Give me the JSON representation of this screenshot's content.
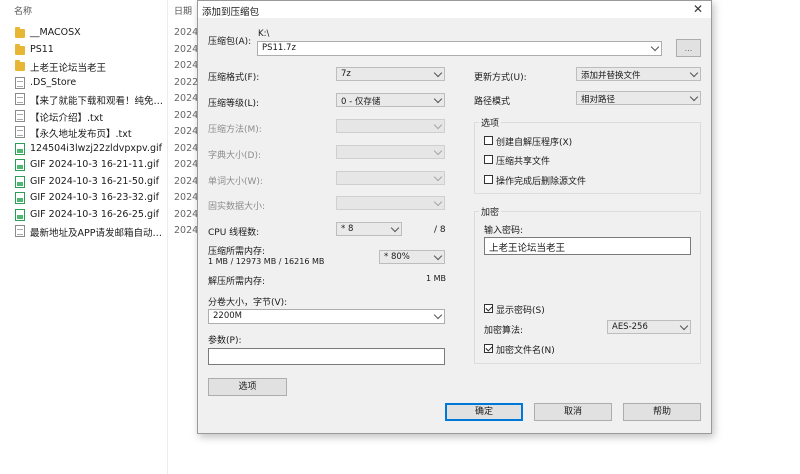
{
  "explorer": {
    "col_name": "名称",
    "col_date": "日期",
    "up_icon": "chevron-up-icon",
    "files": [
      {
        "name": "__MACOSX",
        "date": "2024/",
        "icon": "folder"
      },
      {
        "name": "PS11",
        "date": "2024/",
        "icon": "folder"
      },
      {
        "name": "上老王论坛当老王",
        "date": "2024/",
        "icon": "folder"
      },
      {
        "name": ".DS_Store",
        "date": "2022/",
        "icon": "doc"
      },
      {
        "name": "【来了就能下载和观看！纯免…",
        "date": "2024/",
        "icon": "doc"
      },
      {
        "name": "【论坛介绍】.txt",
        "date": "2024/",
        "icon": "doc"
      },
      {
        "name": "【永久地址发布页】.txt",
        "date": "2024/",
        "icon": "doc"
      },
      {
        "name": "124504i3lwzj22zldvpxpv.gif",
        "date": "2024/",
        "icon": "gif"
      },
      {
        "name": "GIF 2024-10-3 16-21-11.gif",
        "date": "2024/",
        "icon": "gif"
      },
      {
        "name": "GIF 2024-10-3 16-21-50.gif",
        "date": "2024/",
        "icon": "gif"
      },
      {
        "name": "GIF 2024-10-3 16-23-32.gif",
        "date": "2024/",
        "icon": "gif"
      },
      {
        "name": "GIF 2024-10-3 16-26-25.gif",
        "date": "2024/",
        "icon": "gif"
      },
      {
        "name": "最新地址及APP请发邮箱自动…",
        "date": "2024/",
        "icon": "doc"
      }
    ]
  },
  "dialog": {
    "title": "添加到压缩包",
    "close": "✕",
    "archive_label": "压缩包(A):",
    "archive_path": "K:\\",
    "archive_name": "PS11.7z",
    "browse": "...",
    "format_label": "压缩格式(F):",
    "format_value": "7z",
    "level_label": "压缩等级(L):",
    "level_value": "0 - 仅存储",
    "method_label": "压缩方法(M):",
    "dict_label": "字典大小(D):",
    "word_label": "单词大小(W):",
    "solid_label": "固实数据大小:",
    "cpu_label": "CPU 线程数:",
    "cpu_value": "* 8",
    "cpu_total": "/ 8",
    "mem_comp_label": "压缩所需内存:",
    "mem_comp_value": "1 MB / 12973 MB / 16216 MB",
    "mem_percent": "* 80%",
    "mem_decomp_label": "解压所需内存:",
    "mem_decomp_value": "1 MB",
    "split_label": "分卷大小，字节(V):",
    "split_value": "2200M",
    "params_label": "参数(P):",
    "params_value": "",
    "options_button": "选项",
    "update_label": "更新方式(U):",
    "update_value": "添加并替换文件",
    "path_label": "路径模式",
    "path_value": "相对路径",
    "options_group": "选项",
    "opt_sfx": "创建自解压程序(X)",
    "opt_shared": "压缩共享文件",
    "opt_delete": "操作完成后删除源文件",
    "enc_group": "加密",
    "pwd_label": "输入密码:",
    "pwd_value": "上老王论坛当老王",
    "show_pwd": "显示密码(S)",
    "enc_method_label": "加密算法:",
    "enc_method_value": "AES-256",
    "enc_names": "加密文件名(N)",
    "ok": "确定",
    "cancel": "取消",
    "help": "帮助"
  }
}
